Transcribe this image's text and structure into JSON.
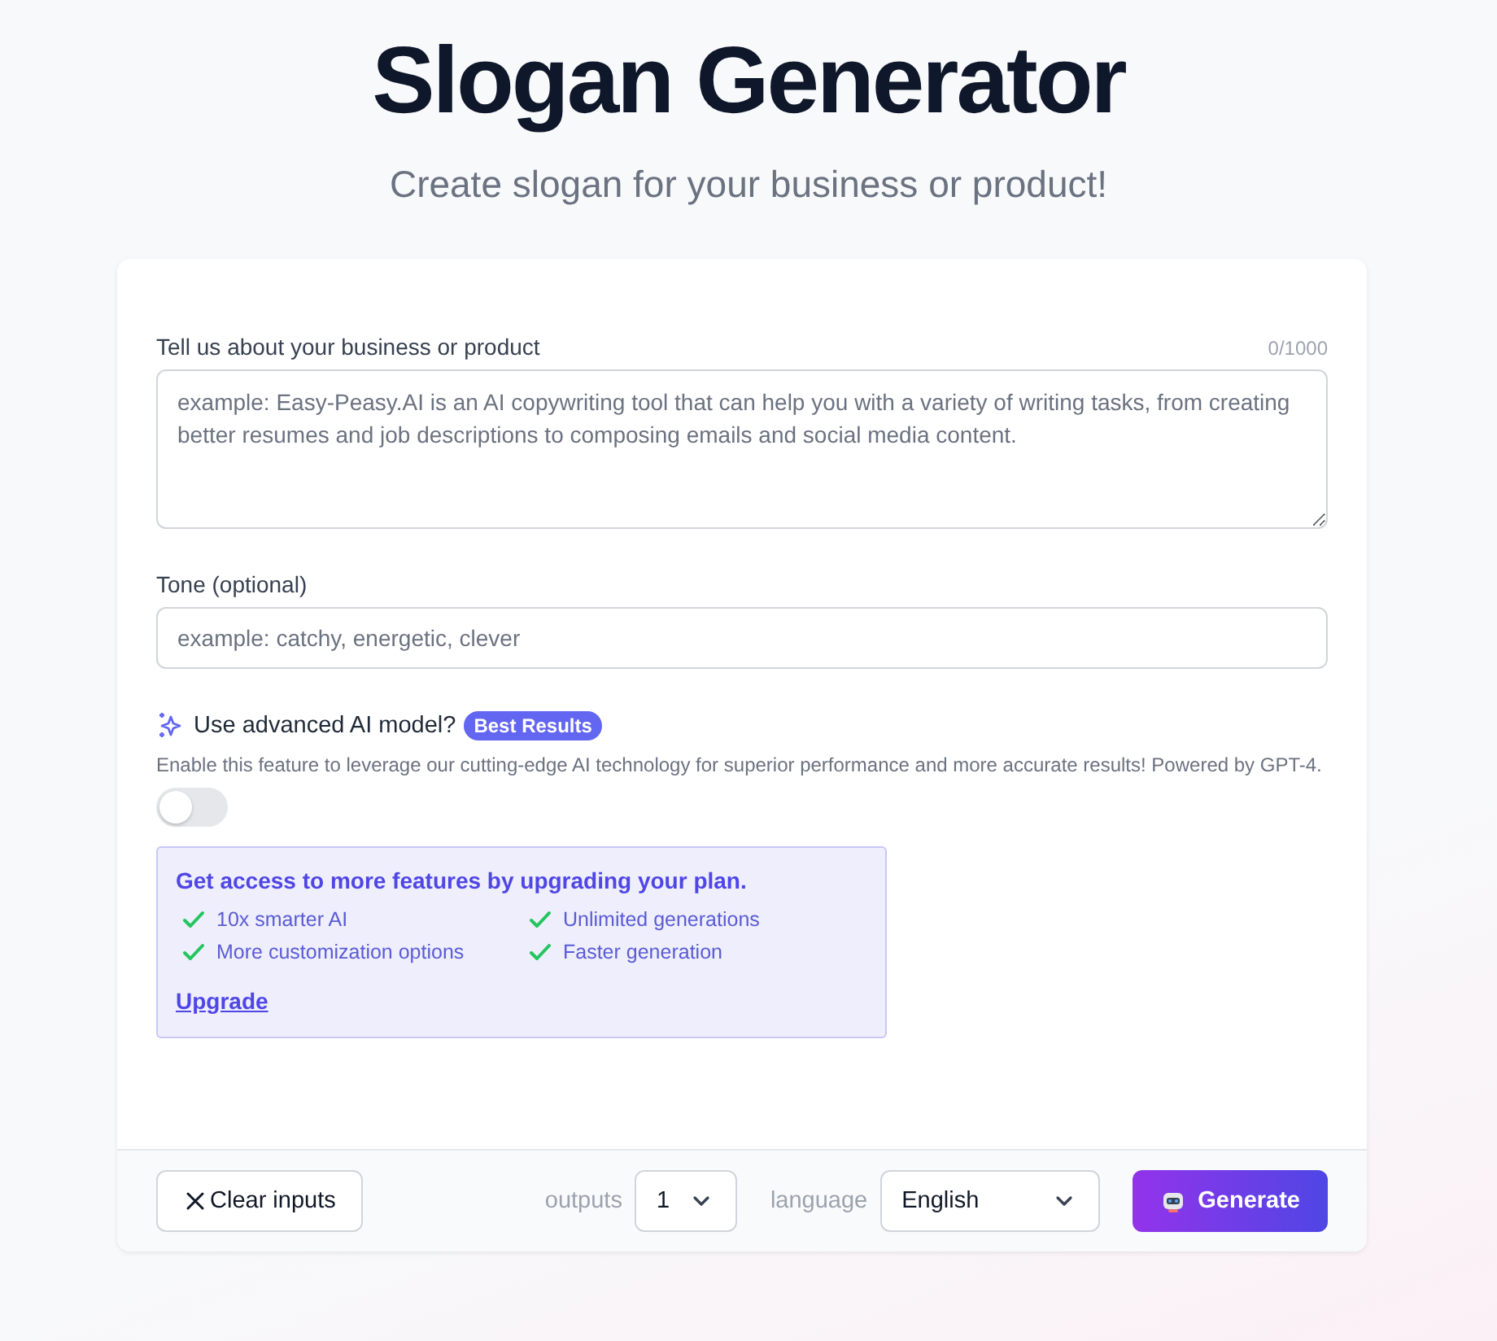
{
  "header": {
    "title": "Slogan Generator",
    "subtitle": "Create slogan for your business or product!"
  },
  "form": {
    "business": {
      "label": "Tell us about your business or product",
      "counter": "0/1000",
      "placeholder": "example: Easy-Peasy.AI is an AI copywriting tool that can help you with a variety of writing tasks, from creating better resumes and job descriptions to composing emails and social media content."
    },
    "tone": {
      "label": "Tone (optional)",
      "placeholder": "example: catchy, energetic, clever"
    },
    "advanced": {
      "label": "Use advanced AI model?",
      "badge": "Best Results",
      "description": "Enable this feature to leverage our cutting-edge AI technology for superior performance and more accurate results! Powered by GPT-4.",
      "on": false
    },
    "upgrade": {
      "title": "Get access to more features by upgrading your plan.",
      "features": [
        "10x smarter AI",
        "Unlimited generations",
        "More customization options",
        "Faster generation"
      ],
      "link": "Upgrade"
    }
  },
  "footer": {
    "clear_button": "Clear inputs",
    "outputs_label": "outputs",
    "outputs_value": "1",
    "language_label": "language",
    "language_value": "English",
    "generate_button": "Generate"
  }
}
